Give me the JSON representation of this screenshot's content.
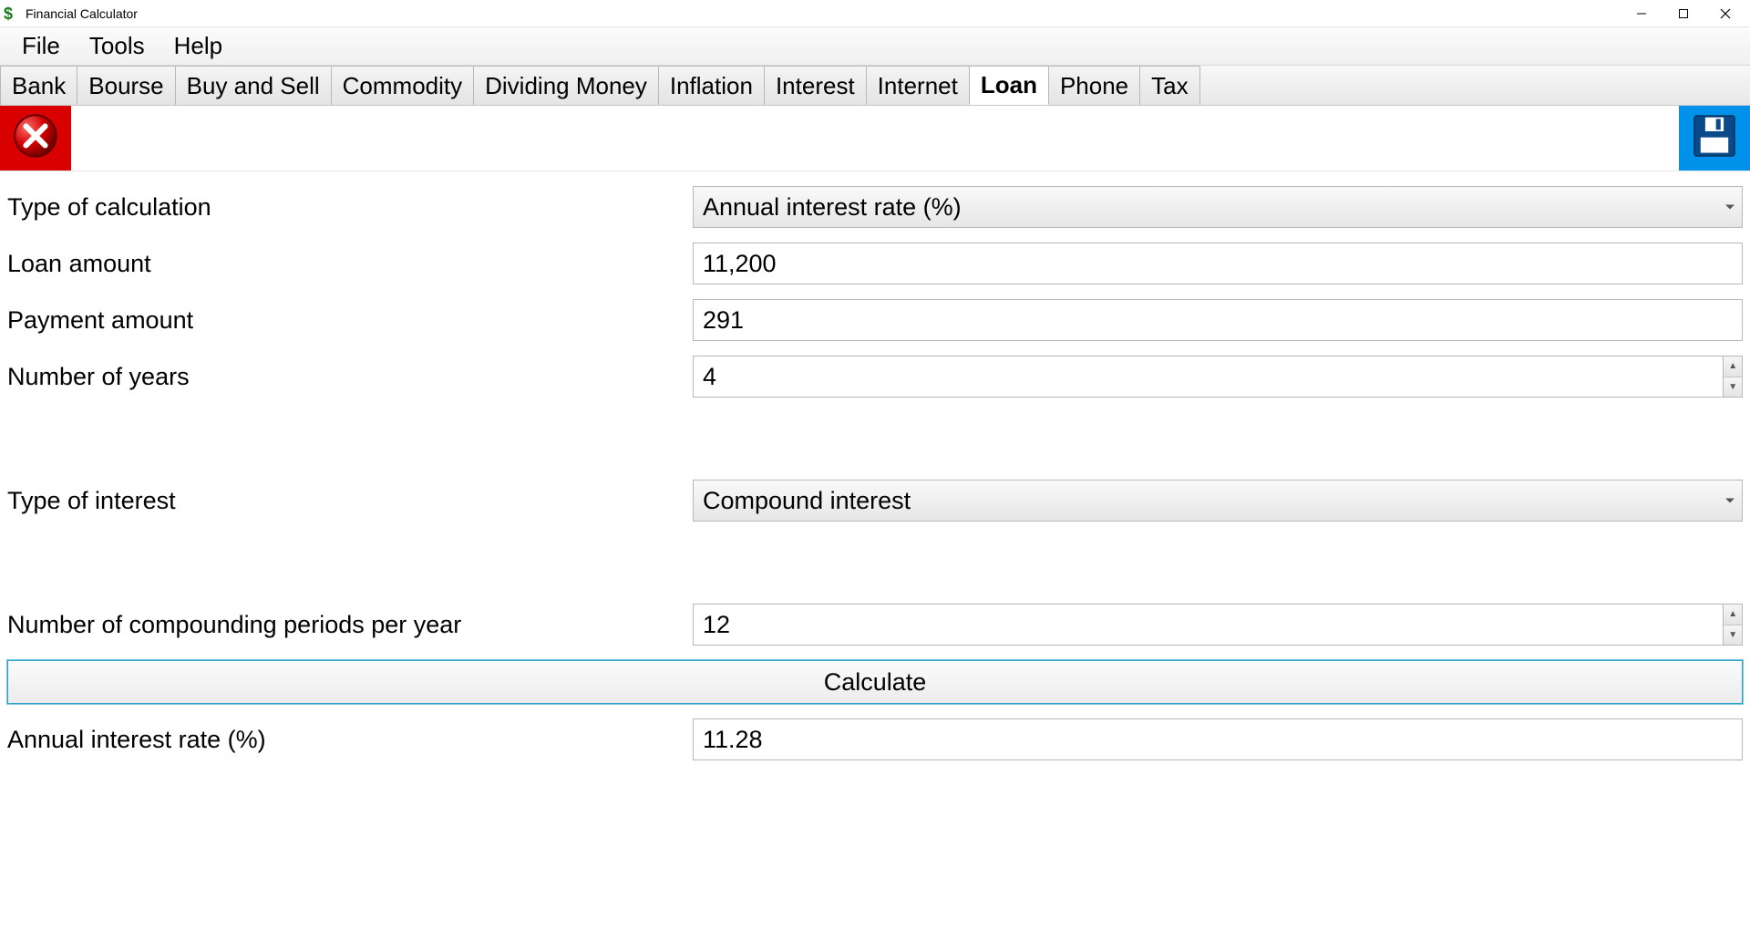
{
  "window": {
    "title": "Financial Calculator"
  },
  "menubar": {
    "items": [
      "File",
      "Tools",
      "Help"
    ]
  },
  "tabs": {
    "items": [
      "Bank",
      "Bourse",
      "Buy and Sell",
      "Commodity",
      "Dividing Money",
      "Inflation",
      "Interest",
      "Internet",
      "Loan",
      "Phone",
      "Tax"
    ],
    "active": "Loan"
  },
  "form": {
    "type_of_calculation": {
      "label": "Type of calculation",
      "value": "Annual interest rate (%)"
    },
    "loan_amount": {
      "label": "Loan amount",
      "value": "11,200"
    },
    "payment_amount": {
      "label": "Payment amount",
      "value": "291"
    },
    "number_of_years": {
      "label": "Number of years",
      "value": "4"
    },
    "type_of_interest": {
      "label": "Type of interest",
      "value": "Compound interest"
    },
    "compounding_periods": {
      "label": "Number of compounding periods per year",
      "value": "12"
    },
    "calculate_label": "Calculate",
    "result": {
      "label": "Annual interest rate (%)",
      "value": "11.28"
    }
  }
}
